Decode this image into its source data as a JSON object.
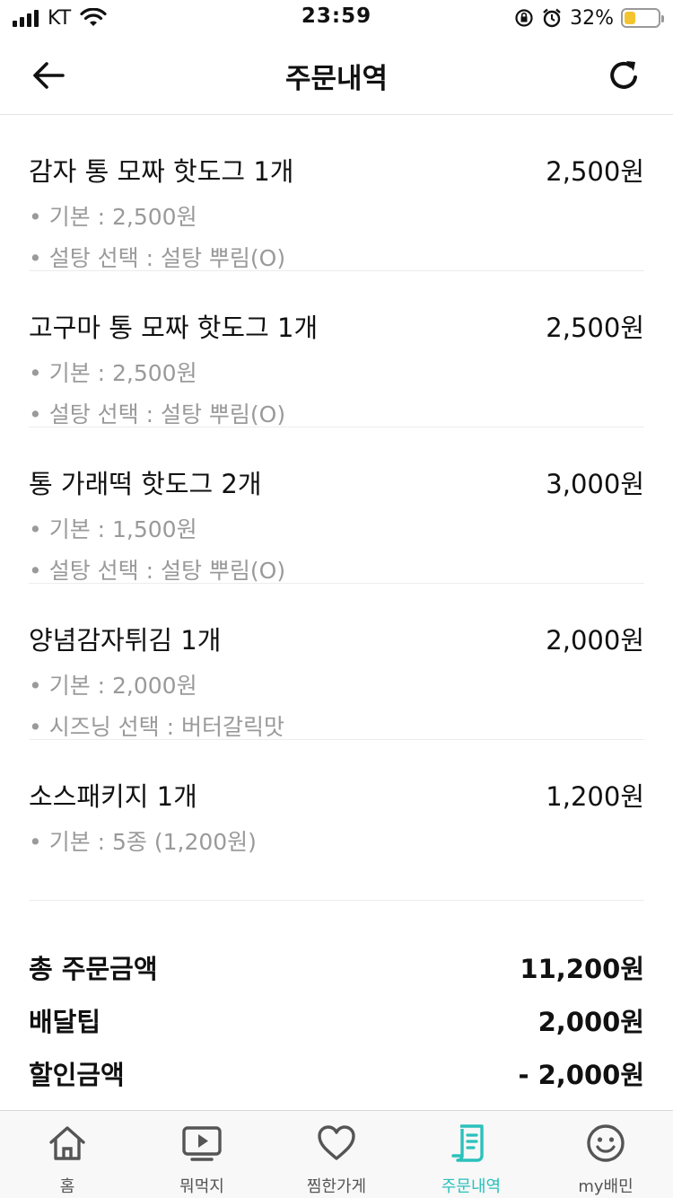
{
  "status_bar": {
    "carrier": "KT",
    "time": "23:59",
    "battery_percent": "32%",
    "battery_level": 0.32,
    "battery_color": "#f4c430"
  },
  "header": {
    "title": "주문내역",
    "back_icon": "arrow-left-icon",
    "refresh_icon": "refresh-icon"
  },
  "order_items": [
    {
      "title": "감자 통 모짜 핫도그 1개",
      "price": "2,500원",
      "options": [
        "• 기본 : 2,500원",
        "• 설탕 선택 : 설탕 뿌림(O)"
      ]
    },
    {
      "title": "고구마 통 모짜 핫도그 1개",
      "price": "2,500원",
      "options": [
        "• 기본 : 2,500원",
        "• 설탕 선택 : 설탕 뿌림(O)"
      ]
    },
    {
      "title": "통 가래떡 핫도그 2개",
      "price": "3,000원",
      "options": [
        "• 기본 : 1,500원",
        "• 설탕 선택 : 설탕 뿌림(O)"
      ]
    },
    {
      "title": "양념감자튀김 1개",
      "price": "2,000원",
      "options": [
        "• 기본 : 2,000원",
        "• 시즈닝 선택 : 버터갈릭맛"
      ]
    },
    {
      "title": "소스패키지 1개",
      "price": "1,200원",
      "options": [
        "• 기본 : 5종 (1,200원)"
      ]
    }
  ],
  "summary": {
    "total_label": "총 주문금액",
    "total_value": "11,200원",
    "delivery_label": "배달팁",
    "delivery_value": "2,000원",
    "discount_label": "할인금액",
    "discount_value": "- 2,000원"
  },
  "tab_bar": {
    "accent_color": "#2ac1bc",
    "tabs": [
      {
        "label": "홈",
        "icon": "home-icon"
      },
      {
        "label": "뭐먹지",
        "icon": "play-screen-icon"
      },
      {
        "label": "찜한가게",
        "icon": "heart-icon"
      },
      {
        "label": "주문내역",
        "icon": "receipt-icon",
        "active": true
      },
      {
        "label": "my배민",
        "icon": "smiley-icon"
      }
    ]
  }
}
